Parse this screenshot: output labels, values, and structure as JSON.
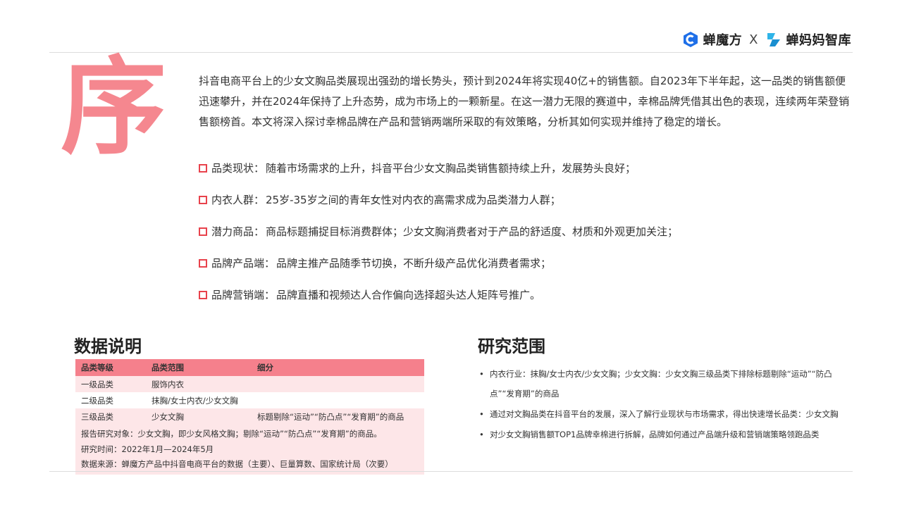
{
  "logo": {
    "left_name": "蝉魔方",
    "separator": "X",
    "right_name": "蝉妈妈智库",
    "left_icon": "chanmofang-logo-icon",
    "right_icon": "chanmama-logo-icon"
  },
  "decor": {
    "big_char": "序"
  },
  "intro": {
    "paragraph": "抖音电商平台上的少女文胸品类展现出强劲的增长势头，预计到2024年将实现40亿+的销售额。自2023年下半年起，这一品类的销售额便迅速攀升，并在2024年保持了上升态势，成为市场上的一颗新星。在这一潜力无限的赛道中，幸棉品牌凭借其出色的表现，连续两年荣登销售额榜首。本文将深入探讨幸棉品牌在产品和营销两端所采取的有效策略，分析其如何实现并维持了稳定的增长。"
  },
  "bullets": [
    {
      "title": "品类现状：",
      "text": "随着市场需求的上升，抖音平台少女文胸品类销售额持续上升，发展势头良好；"
    },
    {
      "title": "内衣人群：",
      "text": "25岁-35岁之间的青年女性对内衣的高需求成为品类潜力人群；"
    },
    {
      "title": "潜力商品：",
      "text": "商品标题捕捉目标消费群体；少女文胸消费者对于产品的舒适度、材质和外观更加关注；"
    },
    {
      "title": "品牌产品端：",
      "text": "品牌主推产品随季节切换，不断升级产品优化消费者需求；"
    },
    {
      "title": "品牌营销端：",
      "text": "品牌直播和视频达人合作偏向选择超头达人矩阵号推广。"
    }
  ],
  "data_section": {
    "title": "数据说明",
    "headers": [
      "品类等级",
      "品类范围",
      "细分"
    ],
    "rows": [
      [
        "一级品类",
        "服饰内衣",
        ""
      ],
      [
        "二级品类",
        "抹胸/女士内衣/少女文胸",
        ""
      ],
      [
        "三级品类",
        "少女文胸",
        "标题剔除“运动”“防凸点”“发育期”的商品"
      ]
    ],
    "notes": [
      "报告研究对象：少女文胸，即少女风格文胸；剔除“运动”“防凸点”“发育期”的商品。",
      "研究时间：2022年1月—2024年5月",
      "数据来源：蝉魔方产品中抖音电商平台的数据（主要）、巨量算数、国家统计局（次要）"
    ],
    "colors": {
      "header_bg": "#f5808c",
      "row_pink": "#fde6e8"
    }
  },
  "scope_section": {
    "title": "研究范围",
    "items": [
      "内衣行业：抹胸/女士内衣/少女文胸；少女文胸：少女文胸三级品类下排除标题剔除“运动”“防凸点”“发育期”的商品",
      "通过对文胸品类在抖音平台的发展，深入了解行业现状与市场需求，得出快速增长品类：少女文胸",
      "对少女文胸销售额TOP1品牌幸棉进行拆解，品牌如何通过产品端升级和营销端策略领跑品类"
    ]
  },
  "colors": {
    "accent_pink": "#f5878f",
    "bullet_red": "#e8424c"
  }
}
